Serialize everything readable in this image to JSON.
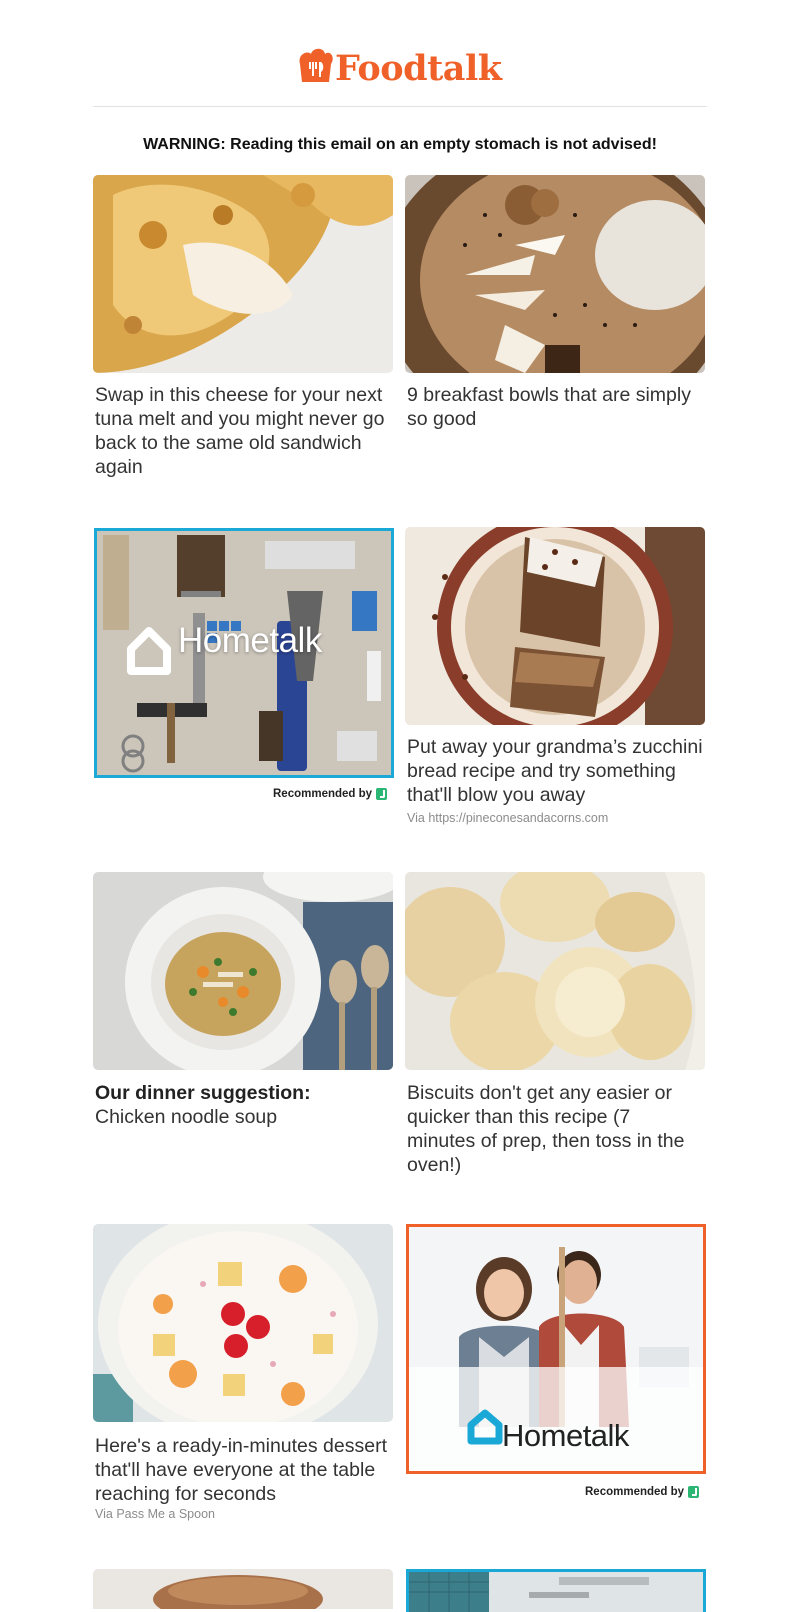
{
  "brand": {
    "name": "Foodtalk",
    "color": "#f0612a"
  },
  "warning": "WARNING: Reading this email on an empty stomach is not advised!",
  "cards": [
    {
      "title": "Swap in this cheese for your next tuna melt and you might never go back to the same old sandwich again",
      "image": "cheese-melt-photo"
    },
    {
      "title": "9 breakfast bowls that are simply so good",
      "image": "breakfast-bowl-photo"
    },
    {
      "title": "Put away your grandma’s zucchini bread recipe and try something that'll blow you away",
      "via": "Via https://pineconesandacorns.com",
      "image": "zucchini-bread-photo"
    },
    {
      "title_bold": "Our dinner suggestion:",
      "title": "Chicken noodle soup",
      "image": "chicken-soup-photo"
    },
    {
      "title": "Biscuits don't get any easier or quicker than this recipe (7 minutes of prep, then toss in the oven!)",
      "image": "biscuits-photo"
    },
    {
      "title": "Here's a ready-in-minutes dessert that'll have everyone at the table reaching for seconds",
      "via": "Via Pass Me a Spoon",
      "image": "fruit-salad-photo"
    }
  ],
  "ads": [
    {
      "logo_text": "Hometalk",
      "recommended": "Recommended by",
      "frame_color": "#1aa8d6"
    },
    {
      "logo_text": "Hometalk",
      "recommended": "Recommended by",
      "frame_color": "#f0612a"
    }
  ]
}
